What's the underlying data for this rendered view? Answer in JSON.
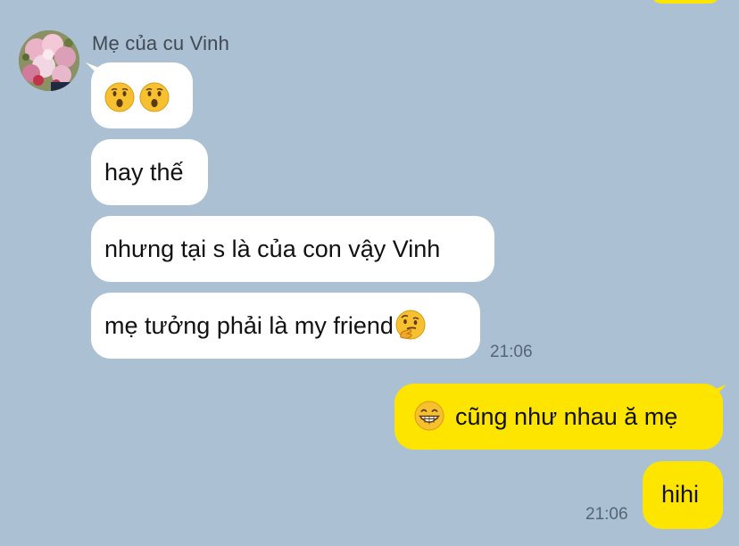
{
  "conversation": {
    "sender": {
      "name": "Mẹ của cu Vinh"
    },
    "incoming": [
      {
        "text": "",
        "emojis": [
          "hushed-face-emoji",
          "hushed-face-emoji"
        ]
      },
      {
        "text": "hay thế"
      },
      {
        "text": "nhưng tại s là của con vậy Vinh"
      },
      {
        "text": "mẹ tưởng phải là my friend",
        "trailing_emoji": "thinking-face-emoji"
      }
    ],
    "incoming_time": "21:06",
    "outgoing": [
      {
        "text": "cũng như nhau ă mẹ",
        "leading_emoji": "grinning-face-emoji"
      },
      {
        "text": "hihi"
      }
    ],
    "outgoing_time": "21:06"
  },
  "colors": {
    "background": "#abc1d3",
    "incoming_bubble": "#ffffff",
    "outgoing_bubble": "#fee500",
    "emoji_yellow": "#f7c02e"
  }
}
